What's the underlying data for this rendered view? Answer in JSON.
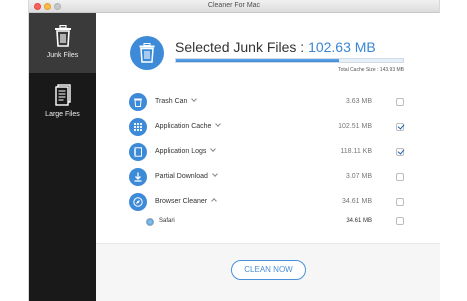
{
  "window": {
    "title": "Cleaner For Mac"
  },
  "sidebar": {
    "items": [
      {
        "label": "Junk Files",
        "icon": "trash-icon",
        "active": true
      },
      {
        "label": "Large Files",
        "icon": "document-stack-icon",
        "active": false
      }
    ]
  },
  "summary": {
    "title_prefix": "Selected Junk Files : ",
    "selected_size": "102.63 MB",
    "progress_fraction": 0.72,
    "total_cache": "Total Cache Size : 143.93 MB"
  },
  "categories": [
    {
      "name": "Trash Can",
      "size": "3.63 MB",
      "checked": false,
      "icon": "trash-icon",
      "chevron": "down"
    },
    {
      "name": "Application Cache",
      "size": "102.51 MB",
      "checked": true,
      "icon": "grid-icon",
      "chevron": "down"
    },
    {
      "name": "Application Logs",
      "size": "118.11 KB",
      "checked": true,
      "icon": "log-book-icon",
      "chevron": "down"
    },
    {
      "name": "Partial Download",
      "size": "3.07 MB",
      "checked": false,
      "icon": "download-icon",
      "chevron": "down"
    },
    {
      "name": "Browser Cleaner",
      "size": "34.61 MB",
      "checked": false,
      "icon": "compass-icon",
      "chevron": "up"
    }
  ],
  "browser_items": [
    {
      "name": "Safari",
      "size": "34.61 MB",
      "checked": false,
      "icon": "safari-icon"
    }
  ],
  "actions": {
    "clean_label": "CLEAN NOW"
  },
  "colors": {
    "accent": "#3d8ad8",
    "sidebar_bg": "#191919",
    "sidebar_active": "#3a3a3a"
  }
}
